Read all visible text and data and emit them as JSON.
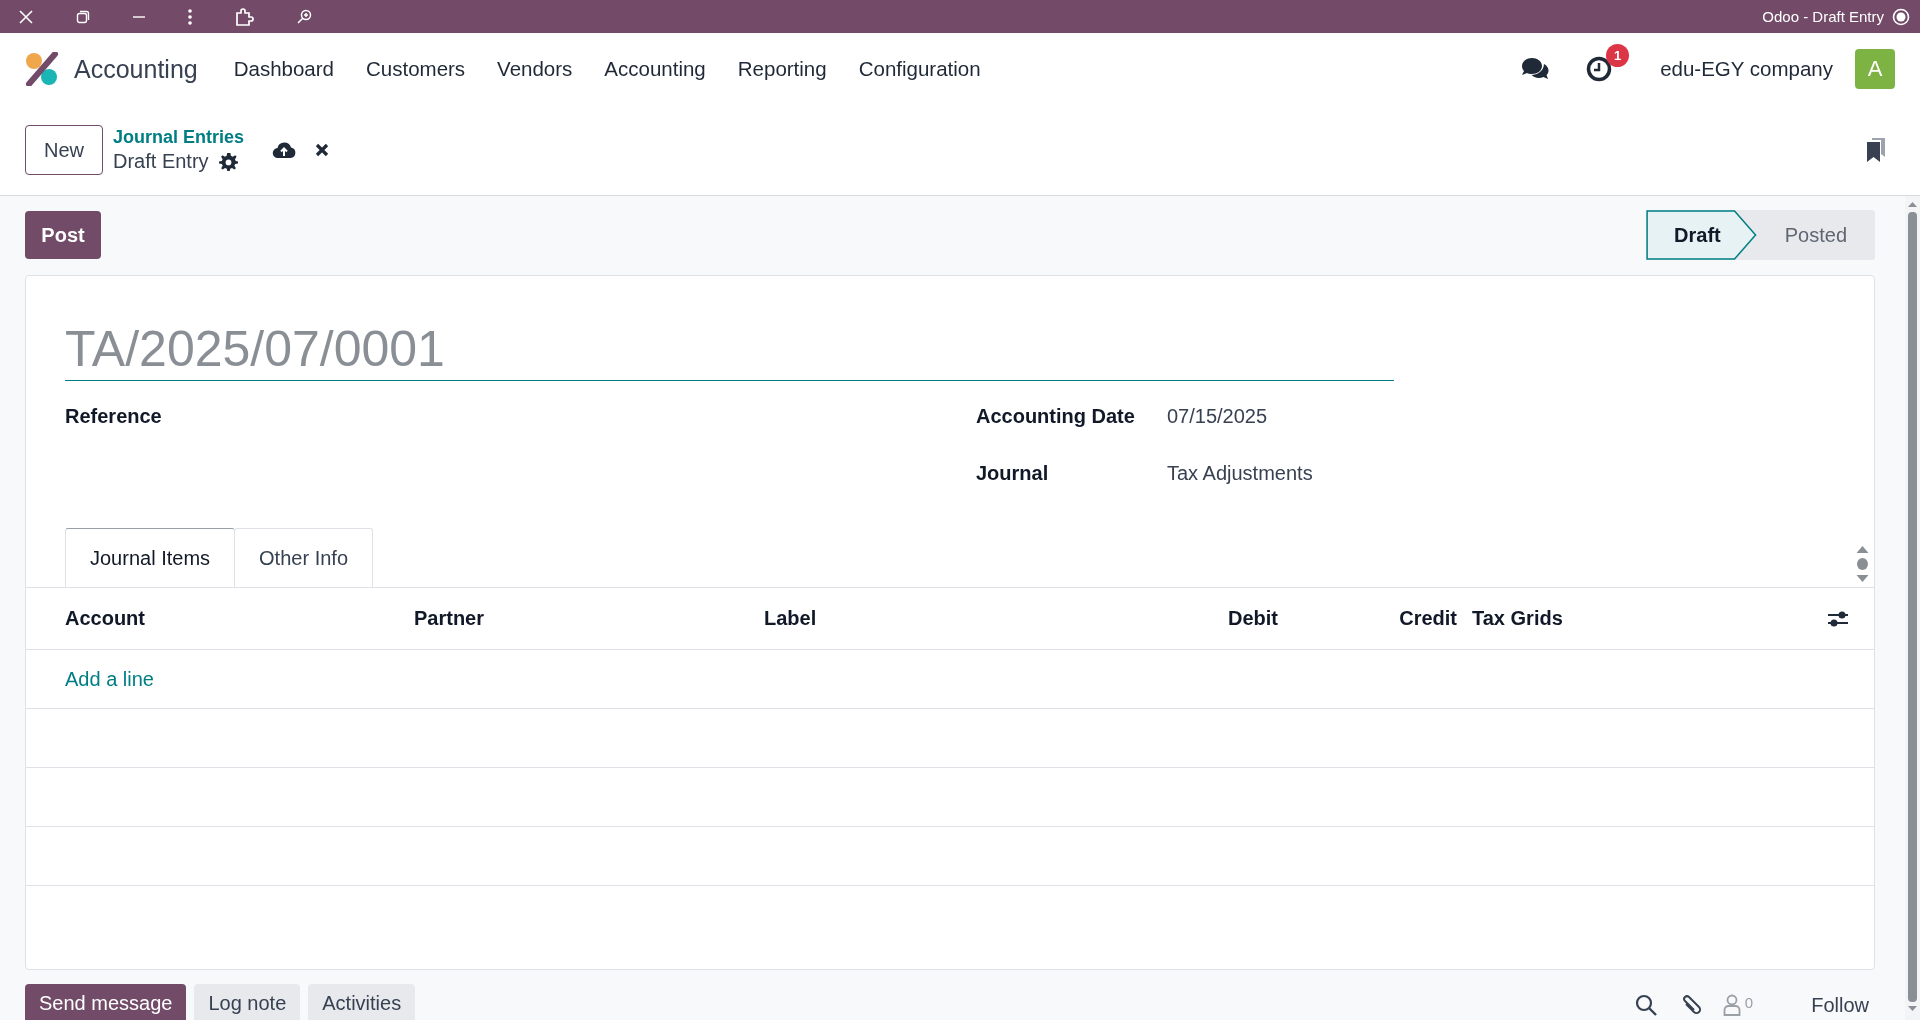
{
  "browser_bar": {
    "title": "Odoo - Draft Entry"
  },
  "navbar": {
    "app_name": "Accounting",
    "menu": [
      "Dashboard",
      "Customers",
      "Vendors",
      "Accounting",
      "Reporting",
      "Configuration"
    ],
    "activity_badge": "1",
    "company": "edu-EGY company",
    "avatar_letter": "A"
  },
  "control_panel": {
    "new_button": "New",
    "breadcrumb": "Journal Entries",
    "record_name": "Draft Entry"
  },
  "form": {
    "post_button": "Post",
    "statuses": [
      {
        "label": "Draft",
        "selected": true
      },
      {
        "label": "Posted",
        "selected": false
      }
    ],
    "title": "TA/2025/07/0001",
    "left_fields": [
      {
        "label": "Reference"
      }
    ],
    "right_fields": [
      {
        "label": "Accounting Date",
        "value": "07/15/2025"
      },
      {
        "label": "Journal",
        "value": "Tax Adjustments"
      }
    ],
    "tabs": [
      {
        "label": "Journal Items",
        "selected": true
      },
      {
        "label": "Other Info",
        "selected": false
      }
    ],
    "table": {
      "columns": [
        {
          "label": "Account",
          "kind": "text"
        },
        {
          "label": "Partner",
          "kind": "text"
        },
        {
          "label": "Label",
          "kind": "text"
        },
        {
          "label": "Debit",
          "kind": "number"
        },
        {
          "label": "Credit",
          "kind": "number"
        },
        {
          "label": "Tax Grids",
          "kind": "text"
        }
      ],
      "add_line": "Add a line"
    }
  },
  "chatter": {
    "buttons": [
      {
        "label": "Send message",
        "selected": true
      },
      {
        "label": "Log note",
        "selected": false
      },
      {
        "label": "Activities",
        "selected": false
      }
    ],
    "follower_count": "0",
    "follow": "Follow"
  }
}
